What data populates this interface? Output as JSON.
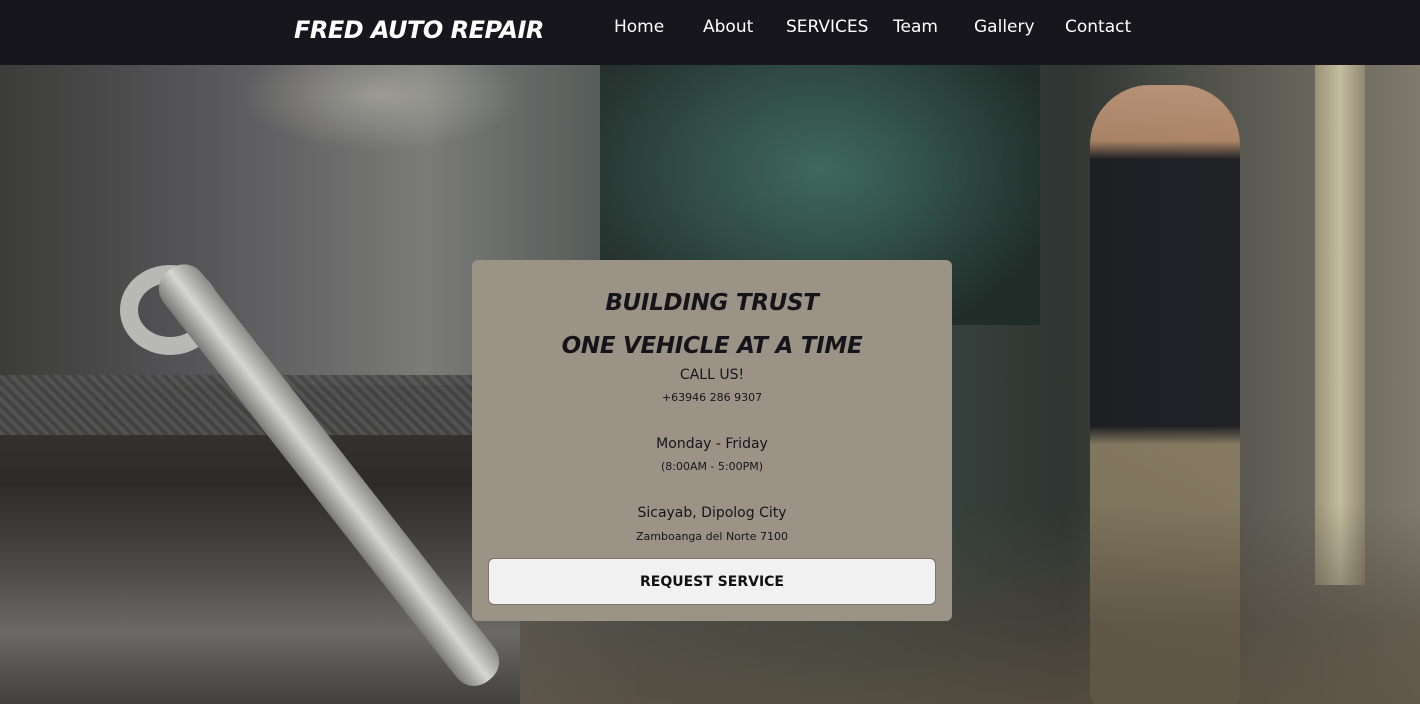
{
  "header": {
    "brand": "FRED AUTO REPAIR",
    "nav": [
      "Home",
      "About",
      "SERVICES",
      "Team",
      "Gallery",
      "Contact"
    ]
  },
  "hero": {
    "headline_line1": "BUILDING TRUST",
    "headline_line2": "ONE VEHICLE AT A TIME",
    "call_label": "CALL US!",
    "phone": "+63946 286 9307",
    "days": "Monday - Friday",
    "hours": "(8:00AM - 5:00PM)",
    "address_line1": "Sicayab, Dipolog City",
    "address_line2": "Zamboanga del Norte 7100",
    "cta_label": "REQUEST SERVICE"
  },
  "colors": {
    "topbar": "#17161d",
    "card": "#9c9387",
    "button": "#f1f1f1"
  }
}
